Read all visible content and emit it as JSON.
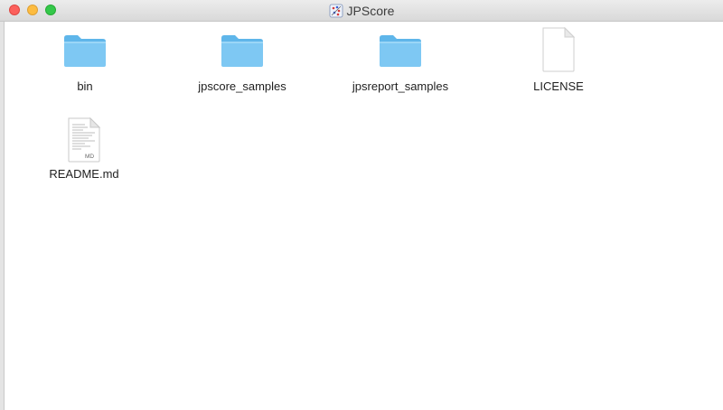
{
  "window": {
    "title": "JPScore",
    "title_icon": "app-icon"
  },
  "controls": {
    "close": "close-button",
    "minimize": "minimize-button",
    "zoom": "zoom-button"
  },
  "items": [
    {
      "label": "bin",
      "icon": "folder-icon"
    },
    {
      "label": "jpscore_samples",
      "icon": "folder-icon"
    },
    {
      "label": "jpsreport_samples",
      "icon": "folder-icon"
    },
    {
      "label": "LICENSE",
      "icon": "document-icon"
    },
    {
      "label": "README.md",
      "icon": "markdown-file-icon",
      "badge": "MD"
    }
  ],
  "colors": {
    "folder_body": "#7ec8f3",
    "folder_tab": "#5fb6ea",
    "titlebar": "#e3e3e3"
  }
}
